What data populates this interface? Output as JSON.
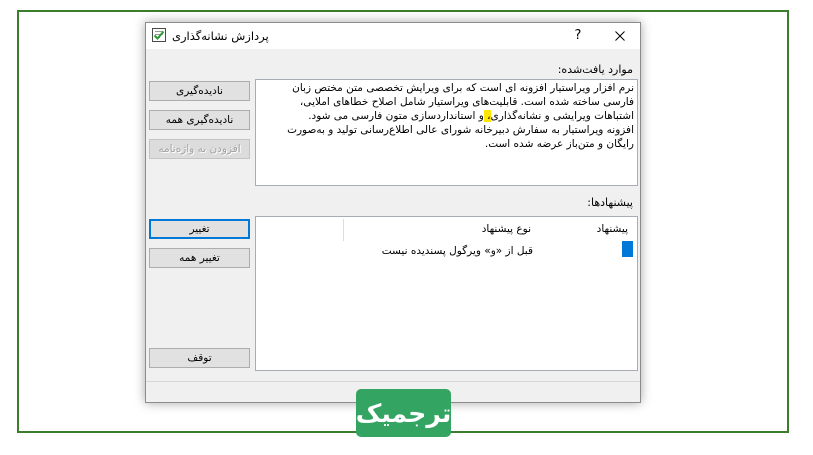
{
  "window": {
    "title": "پردازش نشانه‌گذاری",
    "help_label": "?",
    "title_icon": "proofing-check-icon",
    "close_icon": "close-icon"
  },
  "found": {
    "label": "موارد یافت‌شده:",
    "lines": [
      {
        "text": "نرم افزار ویراستیار افزونه ای است که برای ویرایش تخصصی متن مختص زبان"
      },
      {
        "text": "فارسی ساخته شده است. قابلیت‌های ویراستیار شامل اصلاح خطاهای املایی،"
      },
      {
        "before": "اشتباهات ویرایشی و نشانه‌گذاری",
        "highlight": "، ",
        "after": "و استانداردسازی متون فارسی می شود."
      },
      {
        "text": "افزونه ویراستیار به سفارش دبیرخانه شورای عالی اطلاع‌رسانی تولید و به‌صورت"
      },
      {
        "text": "رایگان و متن‌باز عرضه شده است."
      }
    ]
  },
  "buttons": {
    "ignore": {
      "label": "نادیده‌گیری"
    },
    "ignore_all": {
      "label": "نادیده‌گیری همه"
    },
    "add_to_dictionary": {
      "label": "افزودن به واژه‌نامه",
      "enabled": false
    },
    "change": {
      "label": "تغییر",
      "default": true
    },
    "change_all": {
      "label": "تغییر همه"
    },
    "stop": {
      "label": "توقف"
    }
  },
  "suggestions": {
    "label": "پیشنهادها:",
    "columns": {
      "suggestion": "پیشنهاد",
      "type": "نوع پیشنهاد"
    },
    "rows": [
      {
        "suggestion": "",
        "type": "قبل از «و» ویرگول پسندیده نیست",
        "selected": true
      }
    ]
  },
  "logo": {
    "text": "ترجمیک"
  },
  "colors": {
    "frame": "#3b7d2b",
    "logo": "#33a462",
    "accent": "#0078d7",
    "highlight": "#ffe600",
    "dialog_bg": "#f0f0f0"
  }
}
